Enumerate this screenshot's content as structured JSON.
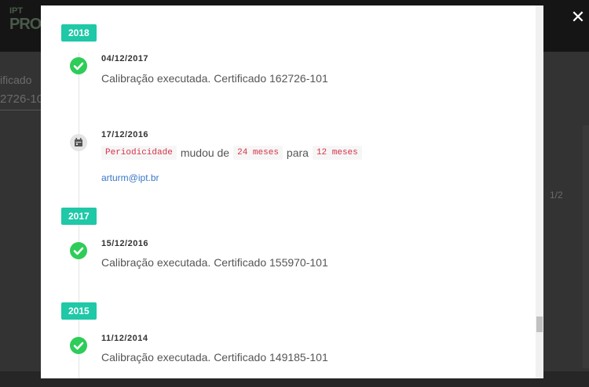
{
  "background": {
    "logo_line1": "IPT",
    "logo_line2": "PRO",
    "field_label": "ificado",
    "field_value": "2726-10",
    "pager": "1/2"
  },
  "close_symbol": "✕",
  "timeline": {
    "years": [
      "2018",
      "2017",
      "2015"
    ],
    "entries": [
      {
        "date": "04/12/2017",
        "text": "Calibração executada. Certificado 162726-101",
        "icon": "check-icon"
      },
      {
        "date": "17/12/2016",
        "icon": "calendar-icon",
        "change": {
          "field": "Periodicidade",
          "verb": "mudou de",
          "from": "24 meses",
          "sep": "para",
          "to": "12 meses"
        },
        "author": "arturm@ipt.br"
      },
      {
        "date": "15/12/2016",
        "text": "Calibração executada. Certificado 155970-101",
        "icon": "check-icon"
      },
      {
        "date": "11/12/2014",
        "text": "Calibração executada. Certificado 149185-101",
        "icon": "check-icon"
      }
    ]
  },
  "colors": {
    "year_badge": "#1fc8a7",
    "check": "#2ecc59",
    "code_text": "#d63348",
    "link": "#3a78c8"
  }
}
